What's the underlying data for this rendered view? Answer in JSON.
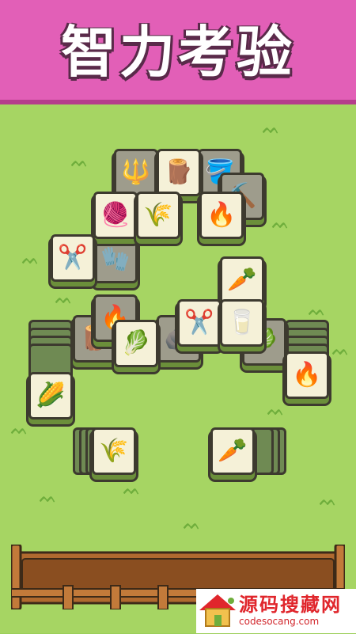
{
  "header": {
    "title": "智力考验",
    "bg_color": "#e25fb7"
  },
  "board": {
    "bg_color": "#a6d563",
    "tiles": [
      {
        "name": "tile-stump",
        "icon": "stump-icon",
        "glyph": "🪵",
        "dim": false
      },
      {
        "name": "tile-yarn",
        "icon": "yarn-icon",
        "glyph": "🧶",
        "dim": false
      },
      {
        "name": "tile-wheat",
        "icon": "wheat-icon",
        "glyph": "🌾",
        "dim": false
      },
      {
        "name": "tile-campfire",
        "icon": "campfire-icon",
        "glyph": "🔥",
        "dim": false
      },
      {
        "name": "tile-shears",
        "icon": "shears-icon",
        "glyph": "✂️",
        "dim": false
      },
      {
        "name": "tile-carrot",
        "icon": "carrot-icon",
        "glyph": "🥕",
        "dim": false
      },
      {
        "name": "tile-cabbage",
        "icon": "cabbage-icon",
        "glyph": "🥬",
        "dim": false
      },
      {
        "name": "tile-shears-2",
        "icon": "shears-icon",
        "glyph": "✂️",
        "dim": false
      },
      {
        "name": "tile-milk",
        "icon": "milk-bottle-icon",
        "glyph": "🥛",
        "dim": false
      },
      {
        "name": "tile-campfire-2",
        "icon": "campfire-icon",
        "glyph": "🔥",
        "dim": false
      },
      {
        "name": "tile-corn",
        "icon": "corn-icon",
        "glyph": "🌽",
        "dim": false
      },
      {
        "name": "tile-wheat-2",
        "icon": "wheat-icon",
        "glyph": "🌾",
        "dim": false
      },
      {
        "name": "tile-carrot-2",
        "icon": "carrot-icon",
        "glyph": "🥕",
        "dim": false
      }
    ],
    "dim_tiles": [
      {
        "name": "dim-tile-bucket",
        "icon": "bucket-icon",
        "glyph": "🪣"
      },
      {
        "name": "dim-tile-fork",
        "icon": "pitchfork-icon",
        "glyph": "🔱"
      },
      {
        "name": "dim-tile-shovel",
        "icon": "shovel-icon",
        "glyph": "⛏️"
      },
      {
        "name": "dim-tile-glove",
        "icon": "glove-icon",
        "glyph": "🧤"
      },
      {
        "name": "dim-tile-stump",
        "icon": "stump-icon",
        "glyph": "🪵"
      },
      {
        "name": "dim-tile-rock",
        "icon": "rock-icon",
        "glyph": "🪨"
      },
      {
        "name": "dim-tile-campfire",
        "icon": "campfire-icon",
        "glyph": "🔥"
      },
      {
        "name": "dim-tile-cabbage",
        "icon": "cabbage-icon",
        "glyph": "🥬"
      }
    ]
  },
  "watermark": {
    "main": "源码搜藏网",
    "url": "codesocang.com"
  }
}
